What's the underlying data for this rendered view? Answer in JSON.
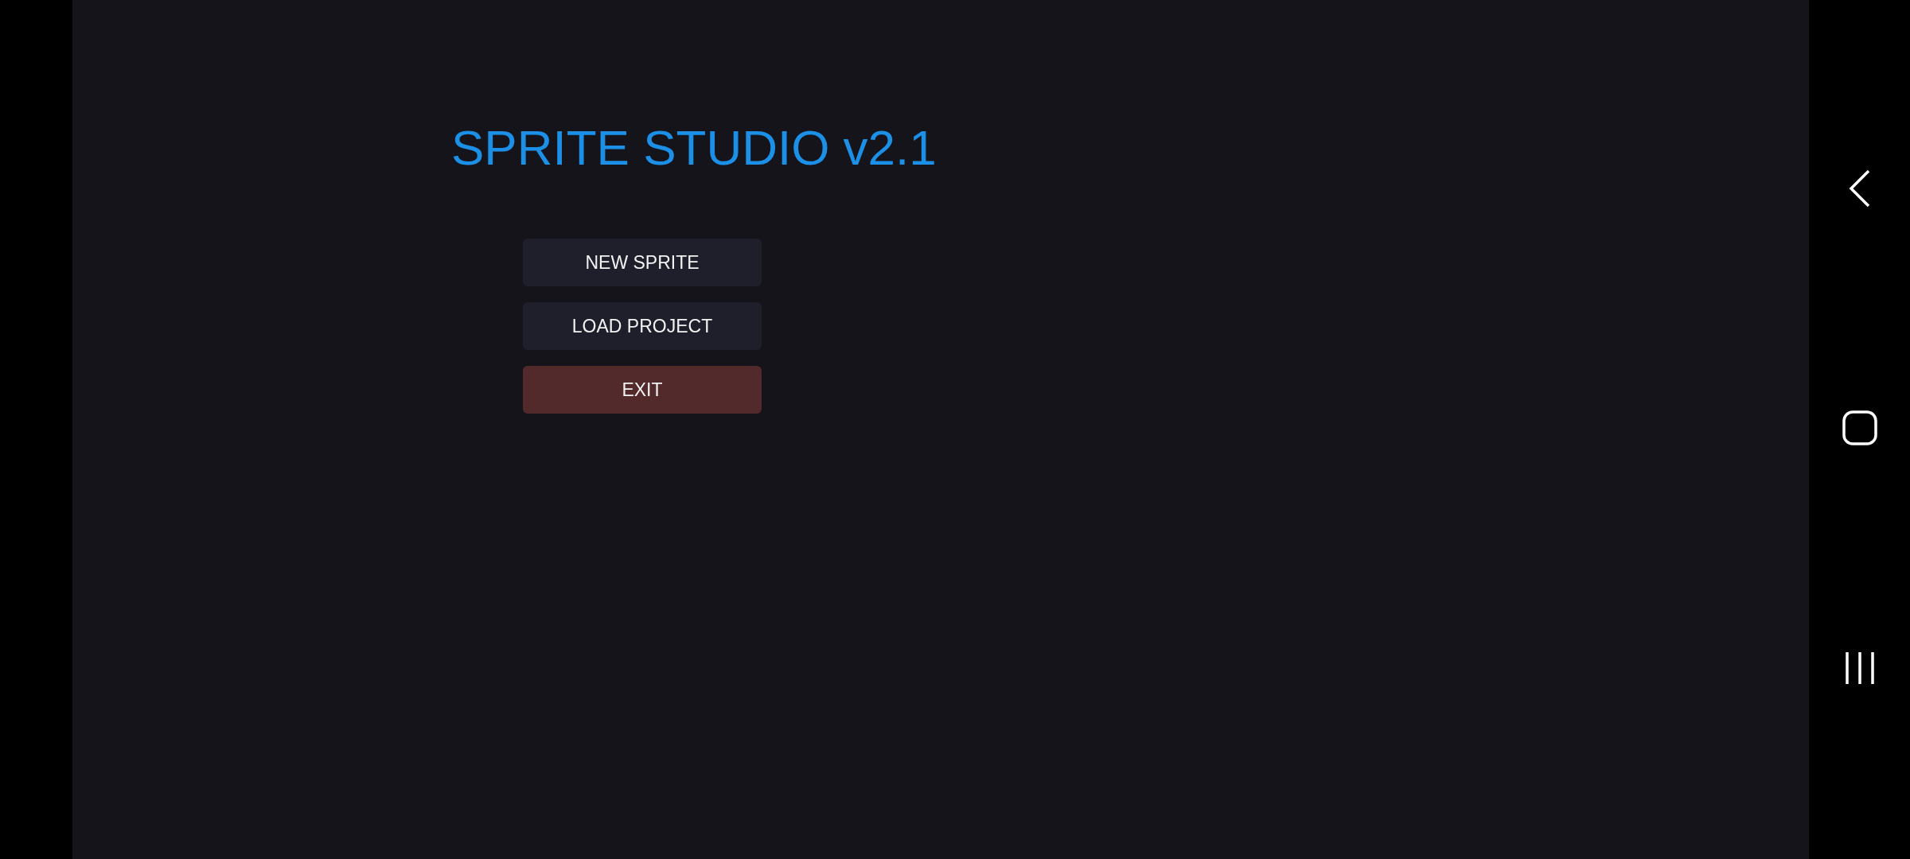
{
  "title": "SPRITE STUDIO v2.1",
  "buttons": [
    {
      "label": "NEW SPRITE",
      "kind": "normal"
    },
    {
      "label": "LOAD PROJECT",
      "kind": "normal"
    },
    {
      "label": "EXIT",
      "kind": "danger"
    }
  ]
}
